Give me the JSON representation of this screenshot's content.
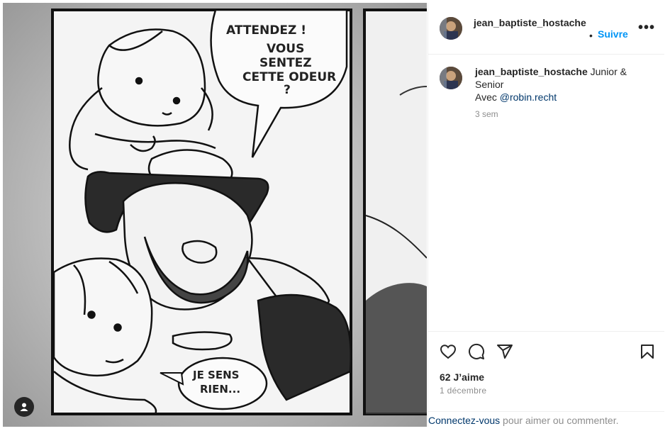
{
  "post": {
    "username_header": "jean_baptiste_hostache",
    "follow_label": "Suivre",
    "more_label": "•••",
    "dot": "•",
    "caption": {
      "username": "jean_baptiste_hostache",
      "text_after_user": " Junior & Senior",
      "line2_prefix": "Avec ",
      "mention": "@robin.recht",
      "time": "3 sem"
    },
    "likes": "62 J’aime",
    "date": "1 décembre",
    "login": {
      "link": "Connectez-vous",
      "text": " pour aimer ou commenter."
    }
  },
  "comic": {
    "bubble_top": [
      "ATTENDEZ !",
      "VOUS",
      "SENTEZ",
      "CETTE ODEUR",
      "?"
    ],
    "bubble_bottom": [
      "JE SENS",
      "RIEN..."
    ]
  },
  "icons": [
    "heart-icon",
    "comment-icon",
    "share-icon",
    "bookmark-icon",
    "user-tag-icon",
    "more-icon"
  ],
  "colors": {
    "link_blue": "#0095f6",
    "mention": "#00376b",
    "muted": "#8e8e8e"
  }
}
